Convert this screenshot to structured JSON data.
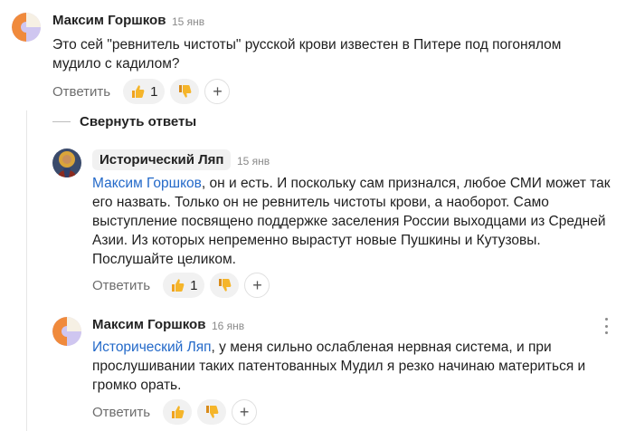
{
  "comments": [
    {
      "author": "Максим Горшков",
      "date": "15 янв",
      "text": "Это сей \"ревнитель чистоты\" русской крови известен в Питере под погонялом мудило с кадилом?",
      "reply_label": "Ответить",
      "likes": "1",
      "avatar_icon": "orange-lavender-avatar"
    },
    {
      "author": "Исторический Ляп",
      "date": "15 янв",
      "mention": "Максим Горшков",
      "text": ", он и есть. И поскольку сам признался, любое СМИ может так его назвать. Только он не ревнитель чистоты крови, а наоборот. Само выступление посвящено поддержке заселения России выходцами из Средней Азии. Из которых непременно вырастут новые Пушкины и Кутузовы. Послушайте целиком.",
      "reply_label": "Ответить",
      "likes": "1",
      "avatar_icon": "icon-painting-avatar"
    },
    {
      "author": "Максим Горшков",
      "date": "16 янв",
      "mention": "Исторический Ляп",
      "text": ", у меня сильно ослабленая нервная система, и при прослушивании таких патентованных Мудил я резко начинаю материться и громко орать.",
      "reply_label": "Ответить",
      "avatar_icon": "orange-lavender-avatar"
    }
  ],
  "thread": {
    "collapse_label": "Свернуть ответы"
  },
  "colors": {
    "mention": "#2369c9",
    "avatar_orange": "#f08a3c",
    "avatar_lavender": "#cfc6f0",
    "pill_bg": "#f1f1f1"
  }
}
